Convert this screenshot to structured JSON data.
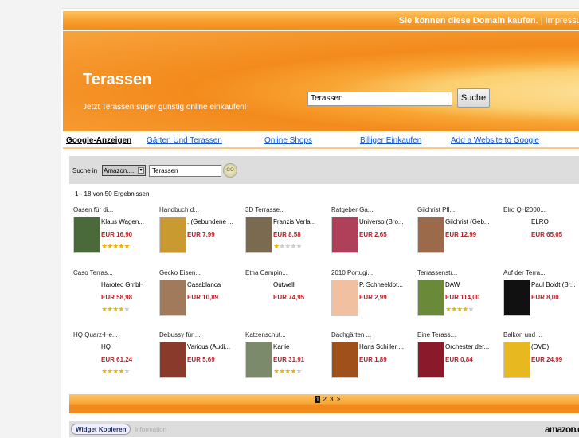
{
  "topbar": {
    "buy": "Sie können diese Domain kaufen.",
    "sep": "|",
    "impressum": "Impressum"
  },
  "header": {
    "title": "Terassen",
    "tagline": "Jetzt Terassen super günstig online einkaufen!",
    "search_value": "Terassen",
    "search_button": "Suche"
  },
  "nav": {
    "label": "Google-Anzeigen",
    "links": [
      "Gärten Und Terassen",
      "Online Shops",
      "Billiger Einkaufen",
      "Add a Website to Google"
    ]
  },
  "widget": {
    "search_label": "Suche in",
    "select_value": "Amazon....",
    "input_value": "Terassen",
    "go": "GO",
    "count": "1 - 18 von 50 Ergebnissen",
    "items": [
      {
        "title": "Oasen für di...",
        "author": "Klaus Wagen...",
        "price": "EUR 16,90",
        "rating": 5,
        "color": "#4a6a3a"
      },
      {
        "title": "Handbuch d...",
        "author": ". (Gebundene ...",
        "price": "EUR 7,99",
        "rating": 0,
        "color": "#c99a30"
      },
      {
        "title": "3D Terrasse...",
        "author": "Franzis Verla...",
        "price": "EUR 8,58",
        "rating": 1,
        "color": "#7a6a50"
      },
      {
        "title": "Ratgeber Ga...",
        "author": "Universo (Bro...",
        "price": "EUR 2,65",
        "rating": 0,
        "color": "#b0405a"
      },
      {
        "title": "Gilchrist Pfl...",
        "author": "Gilchrist (Geb...",
        "price": "EUR 12,99",
        "rating": 0,
        "color": "#9a6a4a"
      },
      {
        "title": "Elro QH2000...",
        "author": "ELRO",
        "price": "EUR 65,05",
        "rating": 0,
        "color": "#ffffff"
      },
      {
        "title": "Caso Terras...",
        "author": "Harotec GmbH",
        "price": "EUR 58,98",
        "rating": 4,
        "color": "#ffffff"
      },
      {
        "title": "Gecko Eisen...",
        "author": "Casablanca",
        "price": "EUR 10,89",
        "rating": 0,
        "color": "#a07a5a"
      },
      {
        "title": "Etna Campin...",
        "author": "Outwell",
        "price": "EUR 74,95",
        "rating": 0,
        "color": "#ffffff"
      },
      {
        "title": "2010 Portugi...",
        "author": "P. Schneeklot...",
        "price": "EUR 2,99",
        "rating": 0,
        "color": "#f0c0a0"
      },
      {
        "title": "Terrassenstr...",
        "author": "DAW",
        "price": "EUR 114,00",
        "rating": 4,
        "color": "#6a8a3a"
      },
      {
        "title": "Auf der Terra...",
        "author": "Paul Boldt (Br...",
        "price": "EUR 8,00",
        "rating": 0,
        "color": "#111111"
      },
      {
        "title": "HQ Quarz-He...",
        "author": "HQ",
        "price": "EUR 61,24",
        "rating": 4,
        "color": "#ffffff"
      },
      {
        "title": "Debussy für ...",
        "author": "Various (Audi...",
        "price": "EUR 5,69",
        "rating": 0,
        "color": "#8a3a2a"
      },
      {
        "title": "Katzenschut...",
        "author": "Karlie",
        "price": "EUR 31,91",
        "rating": 4,
        "color": "#7a8a6a"
      },
      {
        "title": "Dachgärten ...",
        "author": "Hans Schiller ...",
        "price": "EUR 1,89",
        "rating": 0,
        "color": "#a0501a"
      },
      {
        "title": "Eine Terass...",
        "author": "Orchester der...",
        "price": "EUR 0,84",
        "rating": 0,
        "color": "#8a1a2a"
      },
      {
        "title": "Balkon und ...",
        "author": "(DVD)",
        "price": "EUR 24,99",
        "rating": 0,
        "color": "#e8b820"
      }
    ],
    "pages": [
      "1",
      "2",
      "3",
      ">"
    ],
    "copy_button": "Widget Kopieren",
    "info": "Information",
    "logo": "amazon.de"
  }
}
